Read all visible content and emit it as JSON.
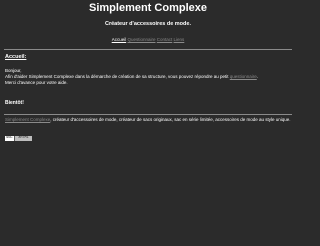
{
  "header": {
    "title": "Simplement Complexe",
    "tagline": "Créateur d'accessoires de mode."
  },
  "nav": {
    "items": [
      {
        "label": "Accueil",
        "current": true
      },
      {
        "label": "Questionnaire",
        "current": false
      },
      {
        "label": "Contact",
        "current": false
      },
      {
        "label": "Liens",
        "current": false
      }
    ]
  },
  "main": {
    "heading": "Accueil:",
    "greeting": "Bonjour,",
    "intro_part1": "Afin d'aider Simplement Complexe dans la démarche de création de sa structure, vous pouvez répondre au petit",
    "intro_link": "questionnaire",
    "intro_part2": ".",
    "thanks": "Merci d'avance pour votre aide.",
    "signoff": "Bientôt!"
  },
  "footer": {
    "brand_link": "Simplement Complexe",
    "description": ", créateur d'accessoires de mode, créateur de sacs originaux, sac en série limitée, accessoires de mode au style unique.",
    "badge": {
      "left": "W3C",
      "right": "XHTML"
    }
  },
  "colors": {
    "background": "#2b2b2b",
    "text": "#ffffff",
    "link": "#8a8a8a"
  }
}
